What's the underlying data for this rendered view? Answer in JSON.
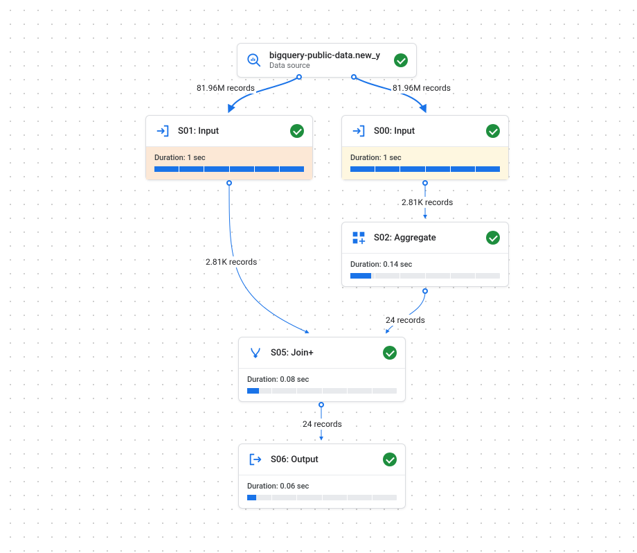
{
  "nodes": {
    "datasource": {
      "title": "bigquery-public-data.new_y",
      "subtitle": "Data source"
    },
    "s01": {
      "title": "S01: Input",
      "duration": "Duration: 1 sec",
      "fill_pct": 100,
      "tint": "#fce8d6"
    },
    "s00": {
      "title": "S00: Input",
      "duration": "Duration: 1 sec",
      "fill_pct": 100,
      "tint": "#fef7e0"
    },
    "s02": {
      "title": "S02: Aggregate",
      "duration": "Duration: 0.14 sec",
      "fill_pct": 14
    },
    "s05": {
      "title": "S05: Join+",
      "duration": "Duration: 0.08 sec",
      "fill_pct": 8
    },
    "s06": {
      "title": "S06: Output",
      "duration": "Duration: 0.06 sec",
      "fill_pct": 6
    }
  },
  "edges": {
    "ds_s01": "81.96M records",
    "ds_s00": "81.96M records",
    "s01_s05": "2.81K records",
    "s00_s02": "2.81K records",
    "s02_s05": "24 records",
    "s05_s06": "24 records"
  }
}
